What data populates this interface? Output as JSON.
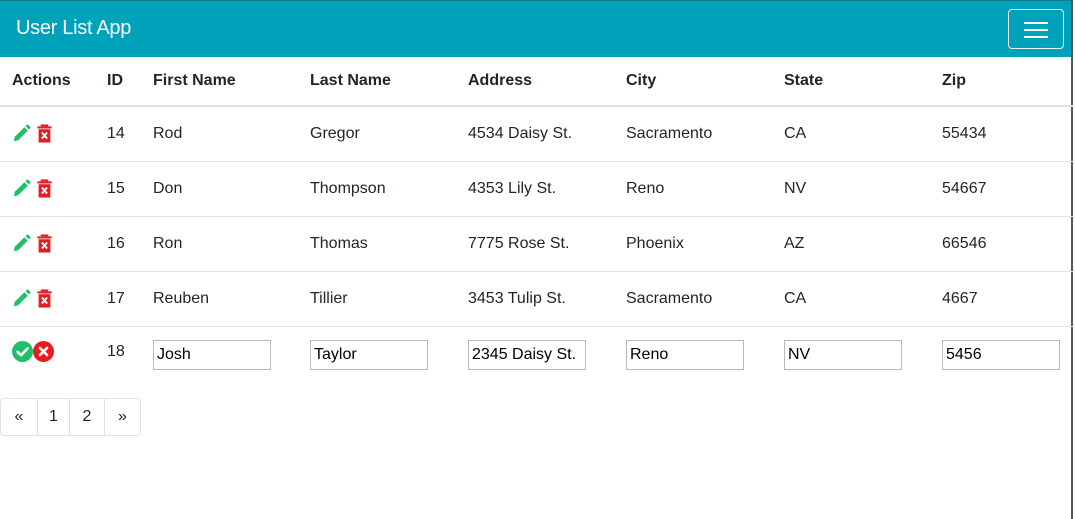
{
  "app": {
    "title": "User List App"
  },
  "table": {
    "columns": [
      "Actions",
      "ID",
      "First Name",
      "Last Name",
      "Address",
      "City",
      "State",
      "Zip"
    ],
    "rows": [
      {
        "id": "14",
        "first": "Rod",
        "last": "Gregor",
        "address": "4534 Daisy St.",
        "city": "Sacramento",
        "state": "CA",
        "zip": "55434"
      },
      {
        "id": "15",
        "first": "Don",
        "last": "Thompson",
        "address": "4353 Lily St.",
        "city": "Reno",
        "state": "NV",
        "zip": "54667"
      },
      {
        "id": "16",
        "first": "Ron",
        "last": "Thomas",
        "address": "7775 Rose St.",
        "city": "Phoenix",
        "state": "AZ",
        "zip": "66546"
      },
      {
        "id": "17",
        "first": "Reuben",
        "last": "Tillier",
        "address": "3453 Tulip St.",
        "city": "Sacramento",
        "state": "CA",
        "zip": "4667"
      }
    ],
    "edit_row": {
      "id": "18",
      "first": "Josh",
      "last": "Taylor",
      "address": "2345 Daisy St.",
      "city": "Reno",
      "state": "NV",
      "zip": "5456"
    }
  },
  "icons": {
    "edit": "pencil-icon",
    "delete": "trash-icon",
    "save": "check-circle-icon",
    "cancel": "x-circle-icon"
  },
  "colors": {
    "navbar": "#00a2b9",
    "edit_icon": "#1fbf6b",
    "delete_icon": "#e51c23",
    "save_icon": "#1fbf6b",
    "cancel_icon": "#e51c23"
  },
  "pagination": {
    "prev": "«",
    "pages": [
      "1",
      "2"
    ],
    "next": "»"
  }
}
